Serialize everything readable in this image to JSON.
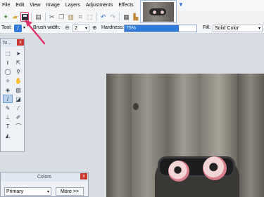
{
  "menu": {
    "items": [
      "File",
      "Edit",
      "View",
      "Image",
      "Layers",
      "Adjustments",
      "Effects"
    ]
  },
  "toolbar": {
    "icons": [
      "new-icon",
      "open-icon",
      "save-icon",
      "print-icon",
      "cut-icon",
      "copy-icon",
      "paste-icon",
      "crop-icon",
      "deselect-icon",
      "undo-icon",
      "redo-icon",
      "grid-icon",
      "ruler-icon"
    ]
  },
  "options": {
    "tool_label": "Tool:",
    "brush_width_label": "Brush width:",
    "brush_width_value": "2",
    "hardness_label": "Hardness:",
    "hardness_value": "75%",
    "hardness_fraction": 0.75,
    "fill_label": "Fill:",
    "fill_value": "Solid Color"
  },
  "tools_window": {
    "title": "To...",
    "close": "x"
  },
  "colors_window": {
    "title": "Colors",
    "close": "x",
    "select_value": "Primary",
    "more_label": "More >>"
  },
  "colors": {
    "accent": "#2f7ad8",
    "highlight_arrow": "#e0336b",
    "close_button": "#c9352c"
  }
}
